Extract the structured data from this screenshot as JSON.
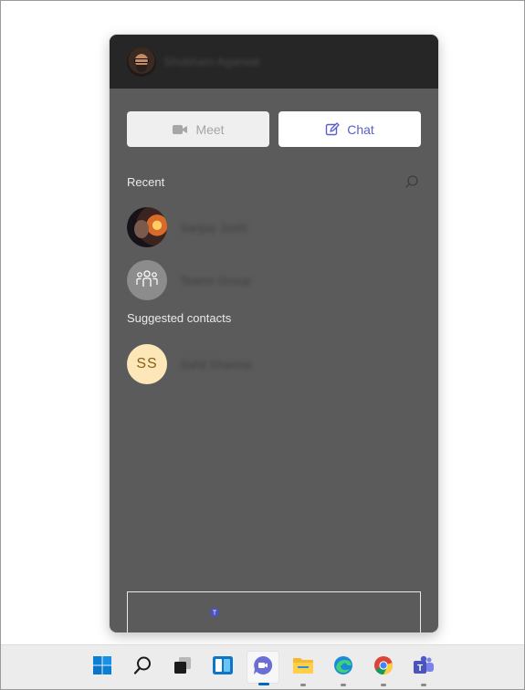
{
  "flyout": {
    "header": {
      "user_name": "Shubham Agarwal"
    },
    "buttons": {
      "meet": "Meet",
      "chat": "Chat"
    },
    "recent": {
      "label": "Recent",
      "items": [
        {
          "name": "Sanjay Joshi",
          "avatar": "photo"
        },
        {
          "name": "Teams Group",
          "avatar": "group-icon"
        }
      ]
    },
    "suggested": {
      "label": "Suggested contacts",
      "items": [
        {
          "name": "Sahil Sharma",
          "initials": "SS"
        }
      ]
    }
  },
  "taskbar": {
    "icons": [
      "windows-start-icon",
      "search-icon",
      "task-view-icon",
      "widgets-icon",
      "chat-icon",
      "file-explorer-icon",
      "edge-icon",
      "chrome-icon",
      "teams-icon"
    ]
  },
  "colors": {
    "flyout_bg": "#5b5b5b",
    "header_bg": "#262626",
    "accent": "#5b5fc7",
    "initials_bg": "#fde7b8",
    "initials_fg": "#8a5d14"
  }
}
